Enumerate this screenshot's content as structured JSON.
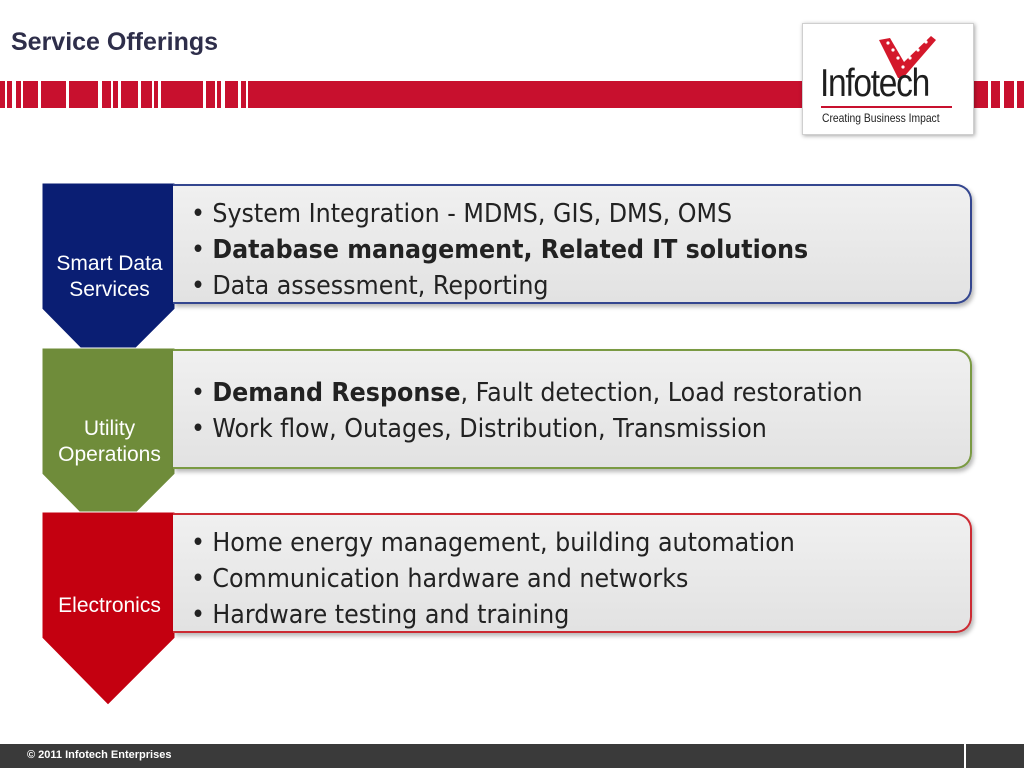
{
  "slide": {
    "title": "Service Offerings",
    "logo": {
      "name": "Infotech",
      "tagline": "Creating Business Impact"
    },
    "footer": "© 2011 Infotech Enterprises",
    "rows": [
      {
        "label": "Smart Data Services",
        "label_lines": [
          "Smart Data",
          "Services"
        ],
        "color": "#0a1e73",
        "border": "#34468f",
        "bullets": [
          {
            "bold": "",
            "text": "System Integration - MDMS, GIS, DMS, OMS"
          },
          {
            "bold": "Database management, Related IT solutions",
            "text": ""
          },
          {
            "bold": "",
            "text": "Data assessment, Reporting"
          }
        ]
      },
      {
        "label": "Utility Operations",
        "label_lines": [
          "Utility",
          "Operations"
        ],
        "color": "#6f8c3a",
        "border": "#7a9a43",
        "bullets": [
          {
            "bold": "Demand Response",
            "text": ", Fault detection, Load restoration"
          },
          {
            "bold": "",
            "text": "Work flow, Outages, Distribution, Transmission"
          }
        ]
      },
      {
        "label": "Electronics",
        "label_lines": [
          "Electronics"
        ],
        "color": "#c40010",
        "border": "#cc2b33",
        "bullets": [
          {
            "bold": "",
            "text": "Home energy management, building automation"
          },
          {
            "bold": "",
            "text": "Communication hardware and networks"
          },
          {
            "bold": "",
            "text": "Hardware testing and training"
          }
        ]
      }
    ]
  }
}
